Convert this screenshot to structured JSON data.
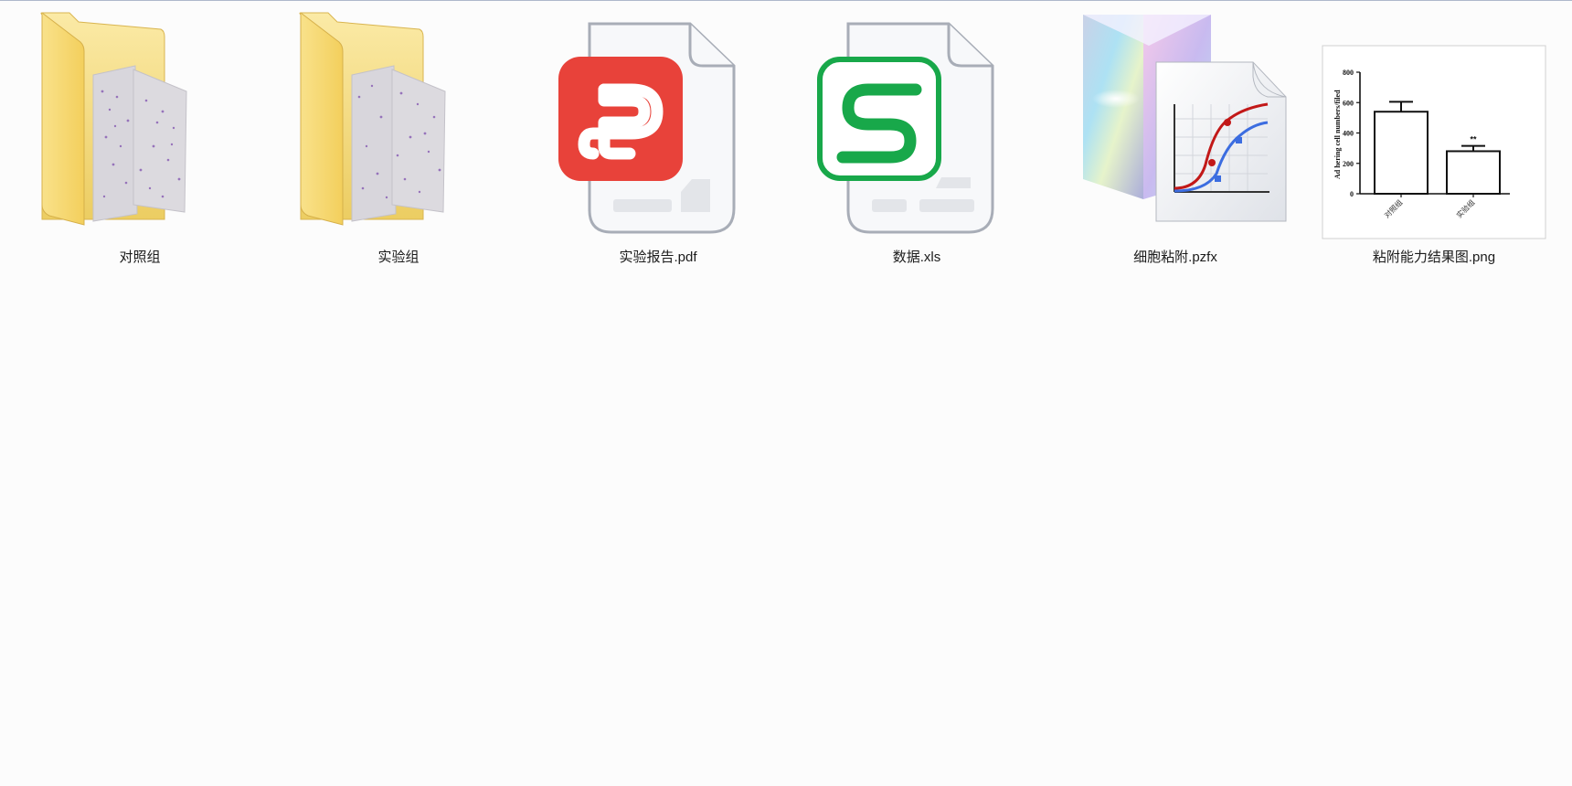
{
  "files": [
    {
      "name": "对照组",
      "icon": "folder-icon"
    },
    {
      "name": "实验组",
      "icon": "folder-icon"
    },
    {
      "name": "实验报告.pdf",
      "icon": "wps-pdf-icon"
    },
    {
      "name": "数据.xls",
      "icon": "wps-spreadsheet-icon"
    },
    {
      "name": "细胞粘附.pzfx",
      "icon": "graphpad-prism-icon"
    },
    {
      "name": "粘附能力结果图.png",
      "icon": "image-thumbnail"
    }
  ],
  "thumbnail_chart": {
    "type": "bar",
    "categories": [
      "对照组",
      "实验组"
    ],
    "values": [
      540,
      280
    ],
    "error": [
      65,
      35
    ],
    "ylabel": "Ad hering cell numbers/filed",
    "yticks": [
      "0",
      "200",
      "400",
      "600",
      "800"
    ],
    "annotation": "**"
  },
  "colors": {
    "folder": "#f6d770",
    "pdf": "#e8423a",
    "spreadsheet": "#18a84a",
    "curve_red": "#c21818",
    "curve_blue": "#3c6de0"
  }
}
